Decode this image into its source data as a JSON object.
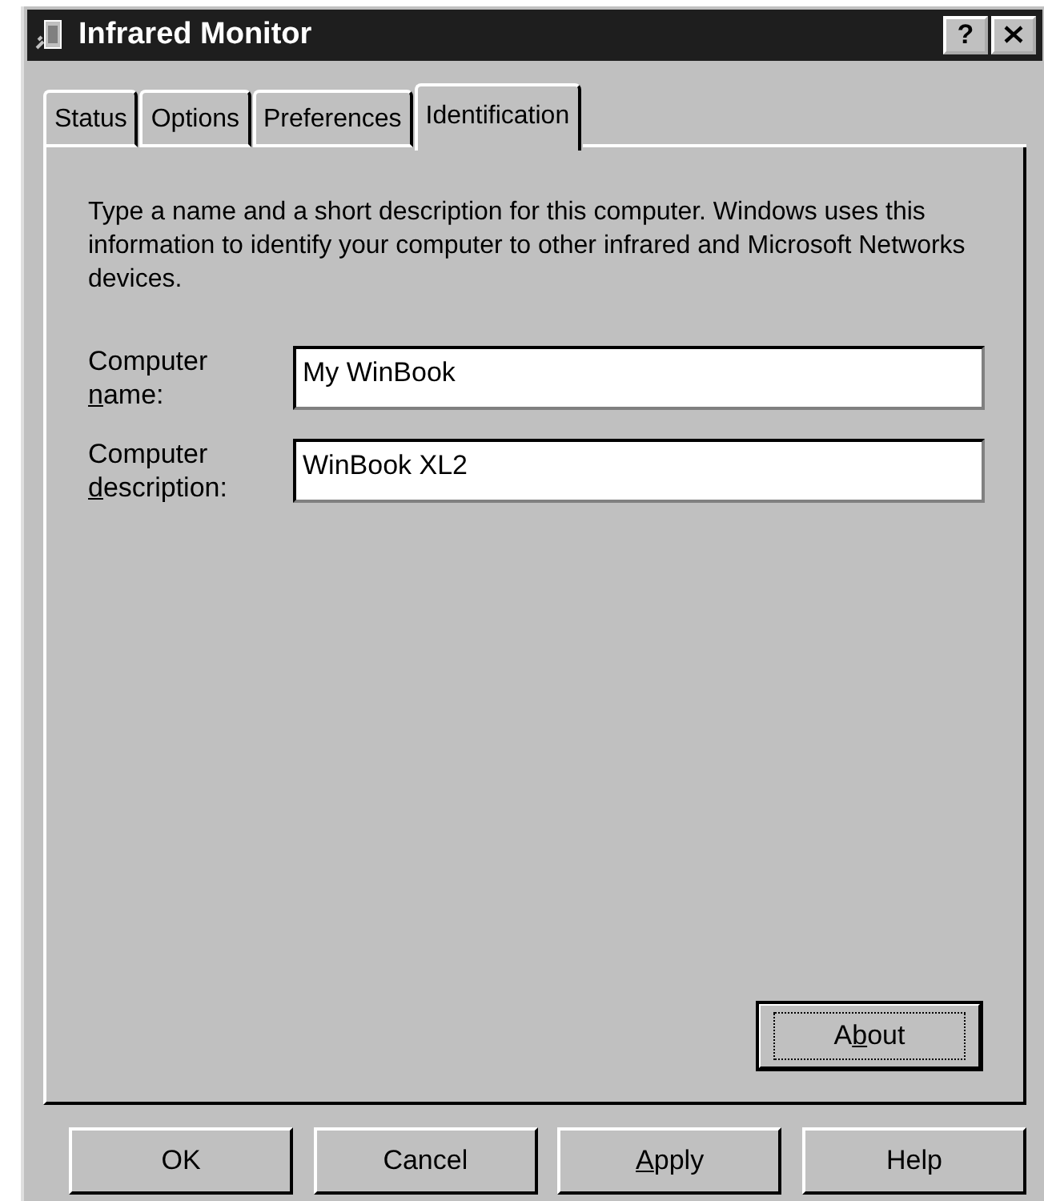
{
  "window": {
    "title": "Infrared Monitor",
    "title_buttons": [
      {
        "kind": "help",
        "label": "?"
      },
      {
        "kind": "close"
      }
    ]
  },
  "tabs": [
    {
      "label": "Status",
      "selected": false
    },
    {
      "label": "Options",
      "selected": false
    },
    {
      "label": "Preferences",
      "selected": false
    },
    {
      "label": "Identification",
      "selected": true
    }
  ],
  "description": "Type a name and a short description for this computer. Windows uses this information to identify your computer to other infrared and Microsoft Networks devices.",
  "fields": [
    {
      "label": [
        {
          "text": "Computer "
        },
        {
          "text": "n",
          "underlined": true
        },
        {
          "text": "ame:"
        }
      ],
      "value": "My WinBook"
    },
    {
      "label": [
        {
          "text": "Computer "
        },
        {
          "text": "d",
          "underlined": true
        },
        {
          "text": "escription:"
        }
      ],
      "value": "WinBook XL2"
    }
  ],
  "about_button": {
    "label": [
      {
        "text": "A"
      },
      {
        "text": "b",
        "underlined": true
      },
      {
        "text": "out"
      }
    ],
    "focused": true
  },
  "buttons": [
    {
      "label": [
        {
          "text": "OK"
        }
      ]
    },
    {
      "label": [
        {
          "text": "Cancel"
        }
      ]
    },
    {
      "label": [
        {
          "text": "A",
          "underlined": true
        },
        {
          "text": "pply"
        }
      ]
    },
    {
      "label": [
        {
          "text": "Help"
        }
      ]
    }
  ]
}
